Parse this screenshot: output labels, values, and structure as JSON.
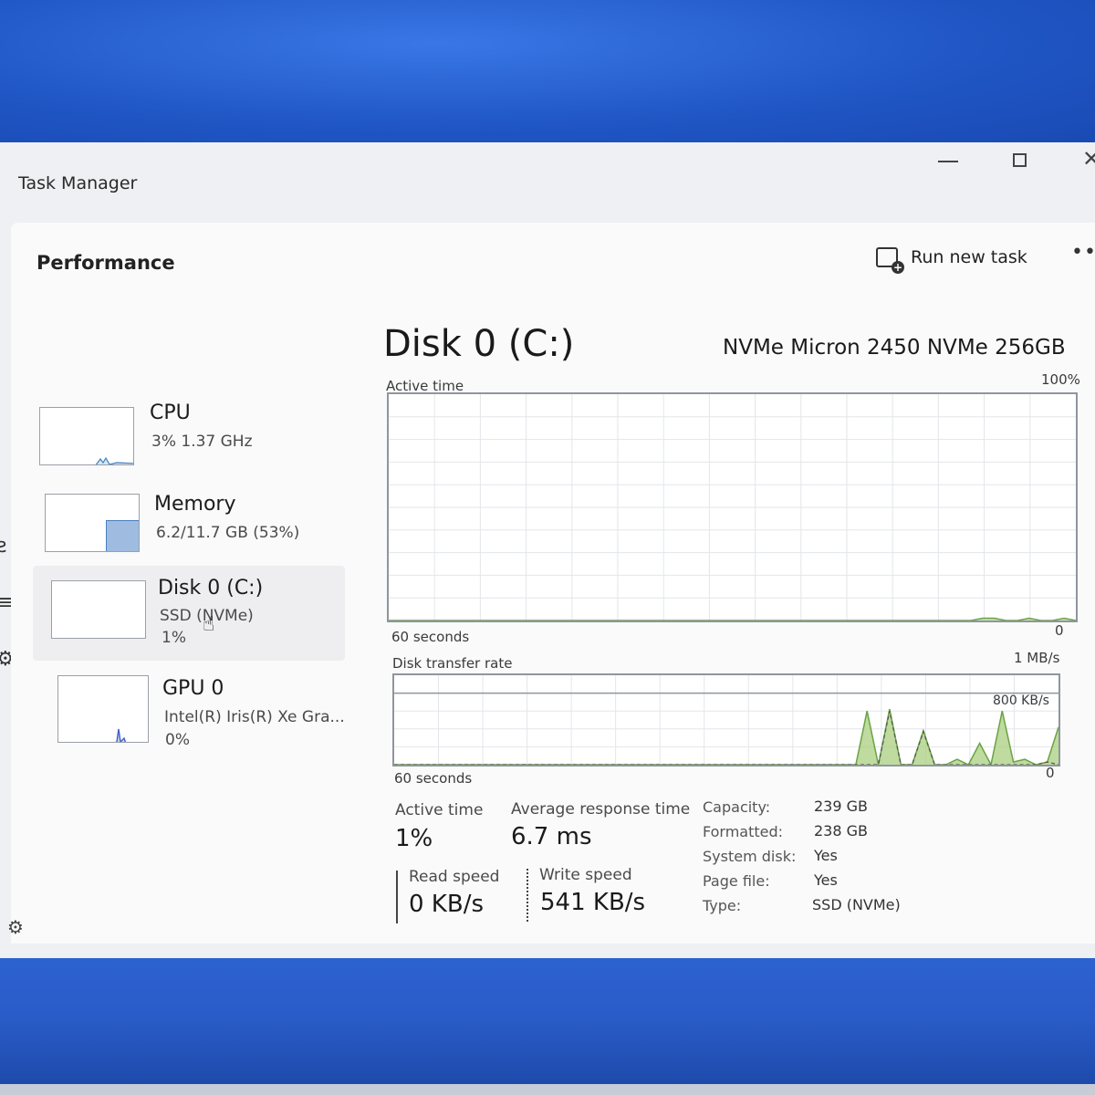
{
  "window": {
    "title": "Task Manager",
    "controls": {
      "minimize": "—",
      "maximize": "",
      "close": "✕"
    }
  },
  "header": {
    "section_title": "Performance",
    "run_new_task": "Run new task",
    "more": "•••"
  },
  "devices": [
    {
      "name": "CPU",
      "line1": "3%  1.37 GHz",
      "line2": ""
    },
    {
      "name": "Memory",
      "line1": "6.2/11.7 GB (53%)",
      "line2": ""
    },
    {
      "name": "Disk 0 (C:)",
      "line1": "SSD (NVMe)",
      "line2": "1%"
    },
    {
      "name": "GPU 0",
      "line1": "Intel(R) Iris(R) Xe Gra...",
      "line2": "0%"
    }
  ],
  "disk": {
    "title": "Disk 0 (C:)",
    "model": "NVMe Micron 2450 NVMe 256GB",
    "active_graph": {
      "label": "Active time",
      "max_label": "100%",
      "time_label": "60 seconds",
      "min_label": "0"
    },
    "transfer_graph": {
      "label": "Disk transfer rate",
      "max_label": "1 MB/s",
      "ref_label": "800 KB/s",
      "time_label": "60 seconds",
      "min_label": "0"
    },
    "stats": {
      "active_time_label": "Active time",
      "active_time_value": "1%",
      "avg_response_label": "Average response time",
      "avg_response_value": "6.7 ms",
      "read_speed_label": "Read speed",
      "read_speed_value": "0 KB/s",
      "write_speed_label": "Write speed",
      "write_speed_value": "541 KB/s"
    },
    "properties": [
      {
        "label": "Capacity:",
        "value": "239 GB"
      },
      {
        "label": "Formatted:",
        "value": "238 GB"
      },
      {
        "label": "System disk:",
        "value": "Yes"
      },
      {
        "label": "Page file:",
        "value": "Yes"
      },
      {
        "label": "Type:",
        "value": "SSD (NVMe)"
      }
    ]
  },
  "chart_data": [
    {
      "type": "area",
      "title": "Active time",
      "ylim": [
        0,
        100
      ],
      "x_span": "60 seconds",
      "series": [
        {
          "values": [
            0,
            0,
            0,
            0,
            0,
            0,
            0,
            0,
            0,
            0,
            0,
            0,
            0,
            0,
            0,
            0,
            0,
            0,
            0,
            0,
            0,
            0,
            0,
            0,
            0,
            0,
            0,
            0,
            0,
            0,
            0,
            0,
            0,
            0,
            0,
            0,
            0,
            0,
            0,
            0,
            0,
            0,
            0,
            0,
            0,
            0,
            0,
            0,
            0,
            0,
            0,
            1,
            1,
            0,
            0,
            1,
            0,
            0,
            1,
            0
          ]
        }
      ]
    },
    {
      "type": "line",
      "title": "Disk transfer rate",
      "ylim": [
        0,
        1000
      ],
      "x_span": "60 seconds",
      "series": [
        {
          "values": [
            0,
            0,
            0,
            0,
            0,
            0,
            0,
            0,
            0,
            0,
            0,
            0,
            0,
            0,
            0,
            0,
            0,
            0,
            0,
            0,
            0,
            0,
            0,
            0,
            0,
            0,
            0,
            0,
            0,
            0,
            0,
            0,
            0,
            0,
            0,
            0,
            0,
            0,
            0,
            0,
            0,
            0,
            600,
            0,
            620,
            0,
            0,
            380,
            0,
            0,
            60,
            0,
            240,
            0,
            600,
            30,
            60,
            0,
            30,
            420
          ]
        },
        {
          "values": [
            0,
            0,
            0,
            0,
            0,
            0,
            0,
            0,
            0,
            0,
            0,
            0,
            0,
            0,
            0,
            0,
            0,
            0,
            0,
            0,
            0,
            0,
            0,
            0,
            0,
            0,
            0,
            0,
            0,
            0,
            0,
            0,
            0,
            0,
            0,
            0,
            0,
            0,
            0,
            0,
            0,
            0,
            0,
            0,
            600,
            0,
            0,
            370,
            0,
            0,
            0,
            0,
            0,
            0,
            0,
            0,
            0,
            0,
            30,
            0
          ]
        }
      ]
    }
  ],
  "colors": {
    "graph_border": "#8f969e",
    "grid": "#e3e6ea",
    "disk_line": "#6aa343",
    "disk_fill": "#a9cf7f",
    "read_line": "#555555",
    "selected_bg": "#eeeef0",
    "memory_fill": "#9fbce0"
  }
}
